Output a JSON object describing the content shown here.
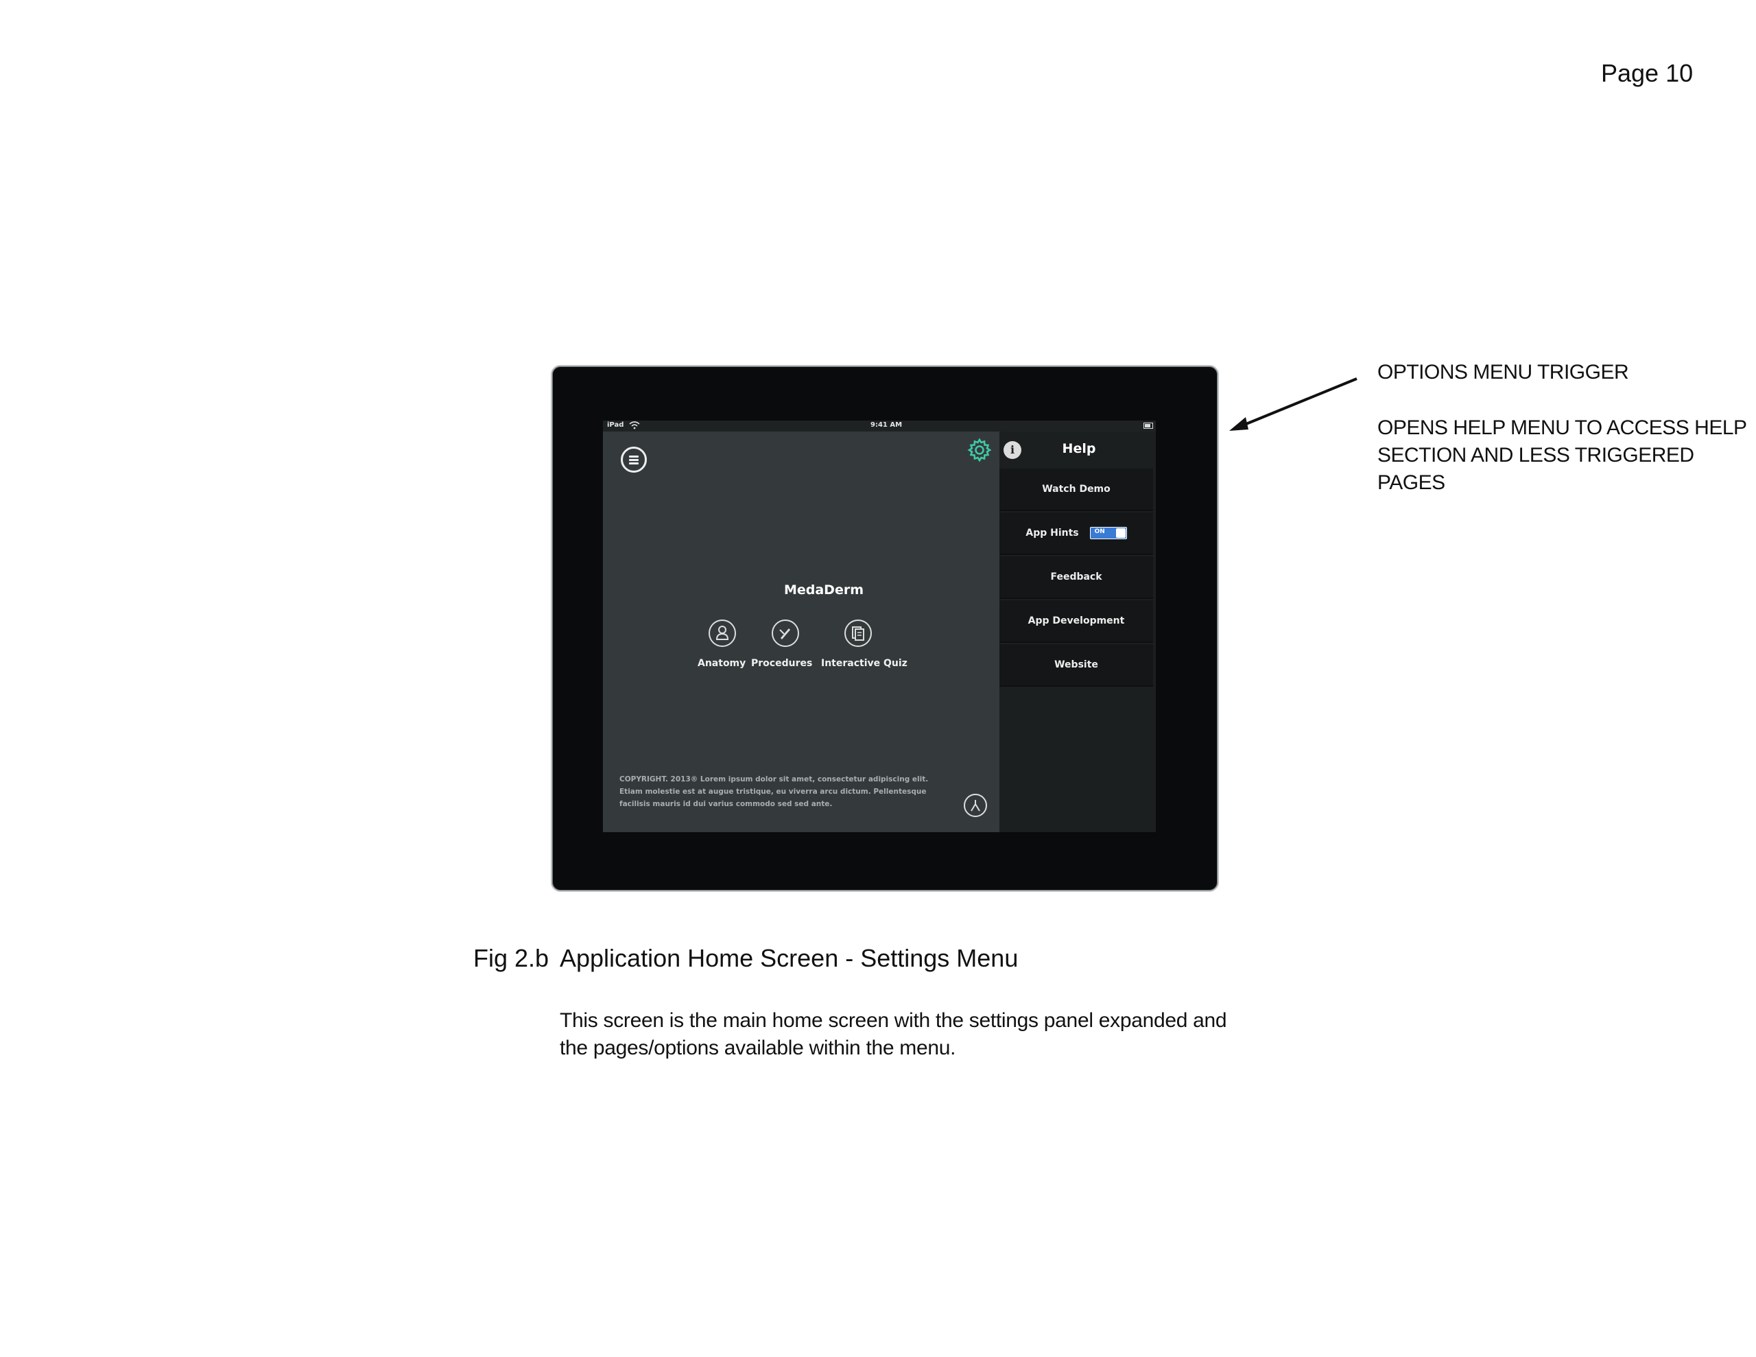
{
  "page": {
    "number_label": "Page 10"
  },
  "annotation": {
    "title": "OPTIONS MENU TRIGGER",
    "description": "OPENS HELP MENU TO ACCESS HELP SECTION AND LESS TRIGGERED PAGES"
  },
  "status_bar": {
    "device": "iPad",
    "time": "9:41 AM"
  },
  "app": {
    "title": "MedaDerm",
    "nav": [
      {
        "label": "Anatomy",
        "icon": "person-icon"
      },
      {
        "label": "Procedures",
        "icon": "scalpel-icon"
      },
      {
        "label": "Interactive Quiz",
        "icon": "clipboard-icon"
      }
    ],
    "copyright": "COPYRIGHT. 2013® Lorem ipsum dolor sit amet, consectetur adipiscing elit. Etiam molestie est at augue tristique, eu viverra arcu dictum. Pellentesque facilisis mauris id dui varius commodo sed sed ante."
  },
  "settings_panel": {
    "title": "Help",
    "items": [
      {
        "label": "Watch Demo"
      },
      {
        "label": "App Hints",
        "toggle": "ON"
      },
      {
        "label": "Feedback"
      },
      {
        "label": "App Development"
      },
      {
        "label": "Website"
      }
    ]
  },
  "figure": {
    "label": "Fig 2.b",
    "title": "Application Home Screen - Settings Menu",
    "description": "This screen is the main home screen with the settings panel expanded and the pages/options available within the menu."
  },
  "colors": {
    "screen_bg": "#343a3b",
    "panel_bg": "#1c1f20",
    "gear_accent": "#3fc9a8",
    "toggle_on": "#3a7bd5"
  }
}
